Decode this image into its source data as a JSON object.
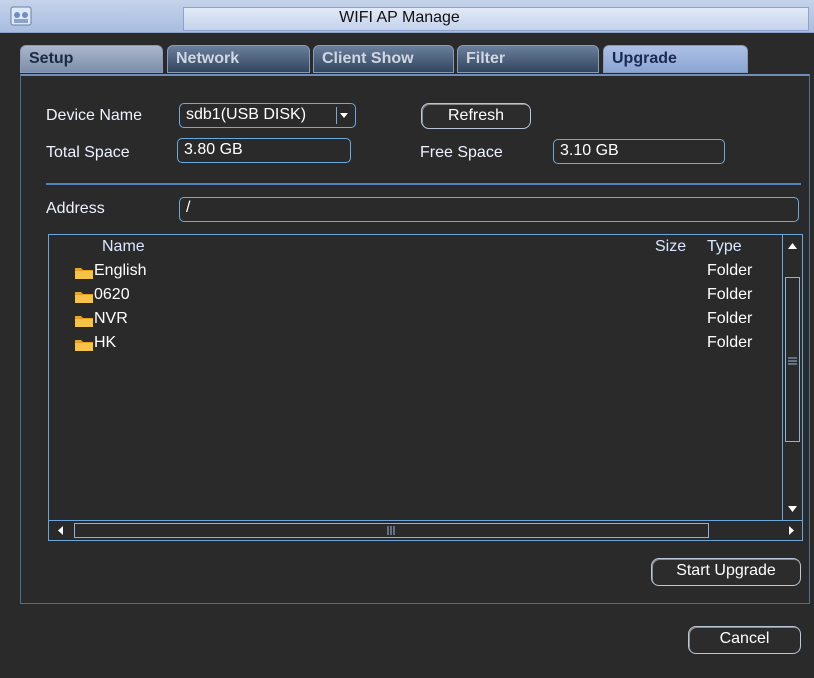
{
  "window": {
    "title": "WIFI AP Manage",
    "icon": "app-icon"
  },
  "tabs": [
    {
      "label": "Setup"
    },
    {
      "label": "Network"
    },
    {
      "label": "Client Show"
    },
    {
      "label": "Filter"
    },
    {
      "label": "Upgrade",
      "active": true
    }
  ],
  "form": {
    "device_name_label": "Device Name",
    "device_name_value": "sdb1(USB DISK)",
    "refresh_label": "Refresh",
    "total_space_label": "Total Space",
    "total_space_value": "3.80 GB",
    "free_space_label": "Free Space",
    "free_space_value": "3.10 GB",
    "address_label": "Address",
    "address_value": "/"
  },
  "file_list": {
    "columns": {
      "name": "Name",
      "size": "Size",
      "type": "Type"
    },
    "rows": [
      {
        "name": "English",
        "size": "",
        "type": "Folder"
      },
      {
        "name": "0620",
        "size": "",
        "type": "Folder"
      },
      {
        "name": "NVR",
        "size": "",
        "type": "Folder"
      },
      {
        "name": "HK",
        "size": "",
        "type": "Folder"
      }
    ]
  },
  "buttons": {
    "start_upgrade": "Start Upgrade",
    "cancel": "Cancel"
  },
  "colors": {
    "background": "#2a2a2a",
    "accent_border": "#6aa6dc",
    "active_tab": "#aec0e4"
  }
}
